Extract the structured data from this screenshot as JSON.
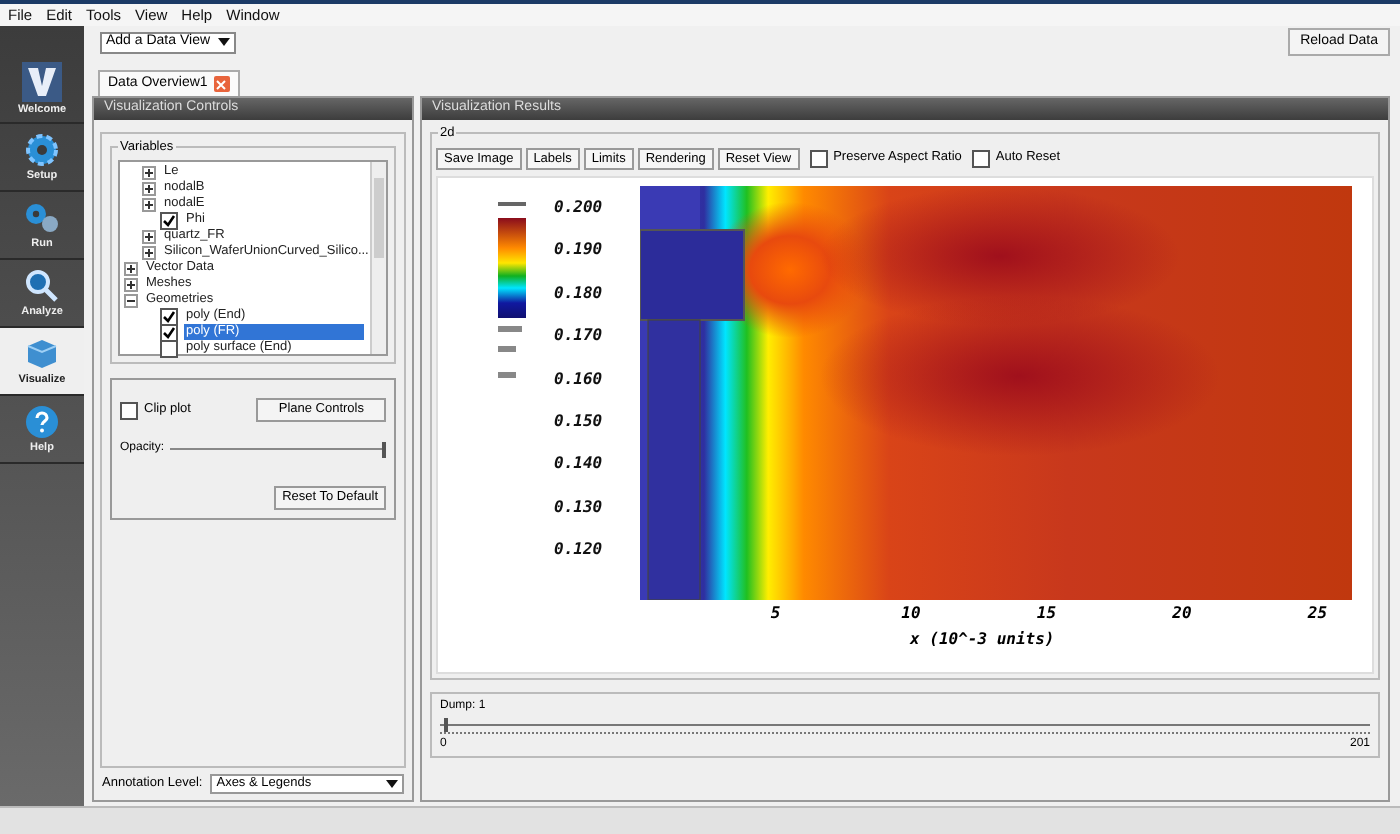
{
  "menu": [
    "File",
    "Edit",
    "Tools",
    "View",
    "Help",
    "Window"
  ],
  "toolbar": {
    "data_view_dropdown": "Add a Data View",
    "reload_button": "Reload Data"
  },
  "sidebar": [
    {
      "label": "Welcome",
      "kind": "logo",
      "selected": false
    },
    {
      "label": "Setup",
      "kind": "gear",
      "selected": false
    },
    {
      "label": "Run",
      "kind": "gears",
      "selected": false
    },
    {
      "label": "Analyze",
      "kind": "magnifier",
      "selected": false
    },
    {
      "label": "Visualize",
      "kind": "cube",
      "selected": true
    },
    {
      "label": "Help",
      "kind": "help",
      "selected": false
    }
  ],
  "tabs": [
    {
      "label": "Data Overview1",
      "selected": true
    }
  ],
  "controls": {
    "title": "Visualization Controls",
    "variables_label": "Variables",
    "tree": [
      {
        "kind": "group",
        "label": "Le",
        "expanded": false,
        "level2": true
      },
      {
        "kind": "group",
        "label": "nodalB",
        "expanded": false,
        "level2": true
      },
      {
        "kind": "group",
        "label": "nodalE",
        "expanded": false,
        "level2": true
      },
      {
        "kind": "check",
        "label": "Phi",
        "checked": true,
        "selected": false,
        "level3": true
      },
      {
        "kind": "group",
        "label": "quartz_FR",
        "expanded": false,
        "level2": true
      },
      {
        "kind": "group",
        "label": "Silicon_WaferUnionCurved_Silico...",
        "expanded": false,
        "level2": true
      },
      {
        "kind": "group",
        "label": "Vector Data",
        "expanded": false
      },
      {
        "kind": "group",
        "label": "Meshes",
        "expanded": false
      },
      {
        "kind": "group",
        "label": "Geometries",
        "expanded": true,
        "children": [
          {
            "kind": "check",
            "label": "poly (End)",
            "checked": true,
            "selected": false
          },
          {
            "kind": "check",
            "label": "poly (FR)",
            "checked": true,
            "selected": true
          },
          {
            "kind": "check",
            "label": "poly surface (End)",
            "checked": false,
            "selected": false
          }
        ]
      }
    ],
    "clip_plot": {
      "label": "Clip plot",
      "checked": false
    },
    "plane_button": "Plane Controls",
    "opacity": {
      "label": "Opacity:",
      "level": 1
    },
    "reset_button": "Reset To Default",
    "annotation": {
      "label": "Annotation Level:",
      "value": "Axes & Legends"
    }
  },
  "results": {
    "title": "Visualization Results",
    "group_label": "2d",
    "buttons": [
      "Save Image",
      "Labels",
      "Limits",
      "Rendering",
      "Reset View"
    ],
    "checks": [
      {
        "label": "Preserve Aspect Ratio",
        "checked": false
      },
      {
        "label": "Auto Reset",
        "checked": false
      }
    ],
    "plot": {
      "yticks": [
        "0.200",
        "0.190",
        "0.180",
        "0.170",
        "0.160",
        "0.150",
        "0.140",
        "0.130",
        "0.120"
      ],
      "xticks": [
        "5",
        "10",
        "15",
        "20",
        "25"
      ],
      "xlabel": "x (10^-3 units)"
    },
    "dump": {
      "label": "Dump: 1",
      "level": 0.005,
      "min": "0",
      "max": "201"
    }
  }
}
